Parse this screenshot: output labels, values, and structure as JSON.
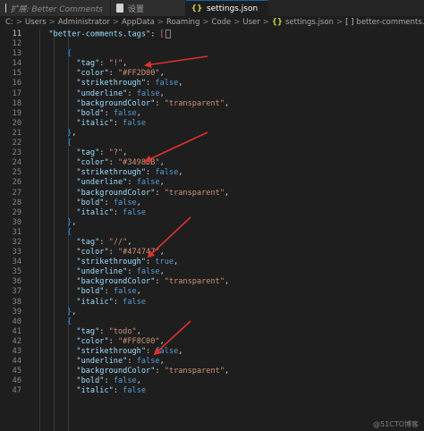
{
  "tabs": [
    {
      "label": "扩展: Better Comments"
    },
    {
      "label": "设置"
    },
    {
      "label": "settings.json"
    }
  ],
  "breadcrumb": {
    "parts": [
      "C:",
      "Users",
      "Administrator",
      "AppData",
      "Roaming",
      "Code",
      "User"
    ],
    "file": "settings.json",
    "array": "[ ]",
    "key": "better-comments.tags"
  },
  "editor": {
    "lines": [
      {
        "n": "11",
        "text": "\"better-comments.tags\": [",
        "kind": "header"
      },
      {
        "n": "12",
        "text": ""
      },
      {
        "n": "13",
        "text": "{"
      },
      {
        "n": "14",
        "key": "tag",
        "val": "!"
      },
      {
        "n": "15",
        "key": "color",
        "val": "#FF2D00"
      },
      {
        "n": "16",
        "key": "strikethrough",
        "bool": "false"
      },
      {
        "n": "17",
        "key": "underline",
        "bool": "false"
      },
      {
        "n": "18",
        "key": "backgroundColor",
        "val": "transparent"
      },
      {
        "n": "19",
        "key": "bold",
        "bool": "false"
      },
      {
        "n": "20",
        "key": "italic",
        "bool": "false",
        "last": true
      },
      {
        "n": "21",
        "text": "},"
      },
      {
        "n": "22",
        "text": "{"
      },
      {
        "n": "23",
        "key": "tag",
        "val": "?"
      },
      {
        "n": "24",
        "key": "color",
        "val": "#3498DB"
      },
      {
        "n": "25",
        "key": "strikethrough",
        "bool": "false"
      },
      {
        "n": "26",
        "key": "underline",
        "bool": "false"
      },
      {
        "n": "27",
        "key": "backgroundColor",
        "val": "transparent"
      },
      {
        "n": "28",
        "key": "bold",
        "bool": "false"
      },
      {
        "n": "29",
        "key": "italic",
        "bool": "false",
        "last": true
      },
      {
        "n": "30",
        "text": "},"
      },
      {
        "n": "31",
        "text": "{"
      },
      {
        "n": "32",
        "key": "tag",
        "val": "//"
      },
      {
        "n": "33",
        "key": "color",
        "val": "#474747"
      },
      {
        "n": "34",
        "key": "strikethrough",
        "bool": "true"
      },
      {
        "n": "35",
        "key": "underline",
        "bool": "false"
      },
      {
        "n": "36",
        "key": "backgroundColor",
        "val": "transparent"
      },
      {
        "n": "37",
        "key": "bold",
        "bool": "false"
      },
      {
        "n": "38",
        "key": "italic",
        "bool": "false",
        "last": true
      },
      {
        "n": "39",
        "text": "},"
      },
      {
        "n": "40",
        "text": "{"
      },
      {
        "n": "41",
        "key": "tag",
        "val": "todo"
      },
      {
        "n": "42",
        "key": "color",
        "val": "#FF8C00"
      },
      {
        "n": "43",
        "key": "strikethrough",
        "bool": "false"
      },
      {
        "n": "44",
        "key": "underline",
        "bool": "false"
      },
      {
        "n": "45",
        "key": "backgroundColor",
        "val": "transparent"
      },
      {
        "n": "46",
        "key": "bold",
        "bool": "false"
      },
      {
        "n": "47",
        "key": "italic",
        "bool": "false",
        "last": true
      }
    ]
  },
  "watermark": "@51CTO博客",
  "colors": {
    "background": "#1e1e1e",
    "key": "#9cdcfe",
    "string": "#ce9178",
    "boolean": "#569cd6",
    "annotation_arrow": "#e03030",
    "brace_outer": "#da70d6",
    "brace_inner": "#179fff"
  }
}
